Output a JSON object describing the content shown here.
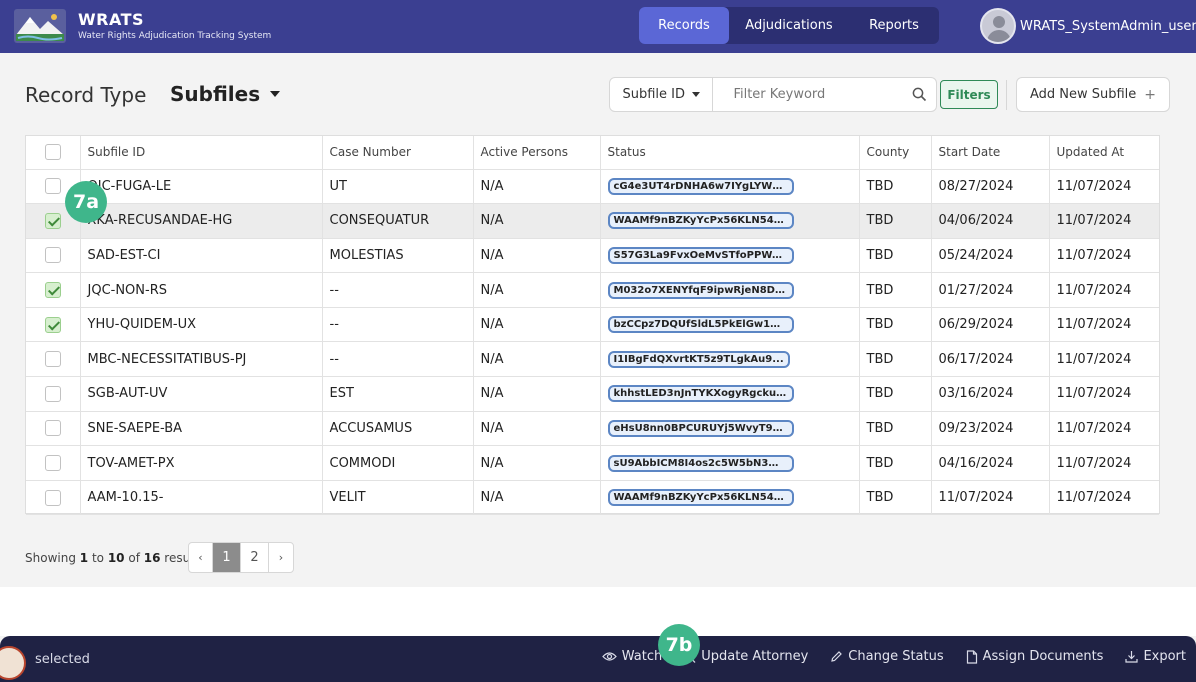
{
  "header": {
    "title": "WRATS",
    "subtitle": "Water Rights Adjudication Tracking System",
    "nav": [
      "Records",
      "Adjudications",
      "Reports"
    ],
    "username": "WRATS_SystemAdmin_user"
  },
  "toolbar": {
    "record_type_label": "Record Type",
    "record_type_value": "Subfiles",
    "filter_field": "Subfile ID",
    "filter_placeholder": "Filter Keyword",
    "filters_label": "Filters",
    "add_label": "Add New Subfile",
    "add_plus": "+"
  },
  "table": {
    "columns": [
      "Subfile ID",
      "Case Number",
      "Active Persons",
      "Status",
      "County",
      "Start Date",
      "Updated At"
    ],
    "rows": [
      {
        "checked": false,
        "id": "OJC-FUGA-LE",
        "case": "UT",
        "persons": "N/A",
        "status": "cG4e3UT4rDNHA6w7IYgLYWxi...",
        "county": "TBD",
        "start": "08/27/2024",
        "updated": "11/07/2024"
      },
      {
        "checked": true,
        "id": "XKA-RECUSANDAE-HG",
        "case": "CONSEQUATUR",
        "persons": "N/A",
        "status": "WAAMf9nBZKyYcPx56KLN54zU...",
        "county": "TBD",
        "start": "04/06/2024",
        "updated": "11/07/2024"
      },
      {
        "checked": false,
        "id": "SAD-EST-CI",
        "case": "MOLESTIAS",
        "persons": "N/A",
        "status": "S57G3La9FvxOeMvSTfoPPWou...",
        "county": "TBD",
        "start": "05/24/2024",
        "updated": "11/07/2024"
      },
      {
        "checked": true,
        "id": "JQC-NON-RS",
        "case": "--",
        "persons": "N/A",
        "status": "M032o7XENYfqF9ipwRjeN8DR...",
        "county": "TBD",
        "start": "01/27/2024",
        "updated": "11/07/2024"
      },
      {
        "checked": true,
        "id": "YHU-QUIDEM-UX",
        "case": "--",
        "persons": "N/A",
        "status": "bzCCpz7DQUfSldL5PkElGw1H...",
        "county": "TBD",
        "start": "06/29/2024",
        "updated": "11/07/2024"
      },
      {
        "checked": false,
        "id": "MBC-NECESSITATIBUS-PJ",
        "case": "--",
        "persons": "N/A",
        "status": "I1IBgFdQXvrtKT5z9TLgkAu9...",
        "county": "TBD",
        "start": "06/17/2024",
        "updated": "11/07/2024"
      },
      {
        "checked": false,
        "id": "SGB-AUT-UV",
        "case": "EST",
        "persons": "N/A",
        "status": "khhstLED3nJnTYKXogyRgcku...",
        "county": "TBD",
        "start": "03/16/2024",
        "updated": "11/07/2024"
      },
      {
        "checked": false,
        "id": "SNE-SAEPE-BA",
        "case": "ACCUSAMUS",
        "persons": "N/A",
        "status": "eHsU8nn0BPCURUYj5WvyT90q...",
        "county": "TBD",
        "start": "09/23/2024",
        "updated": "11/07/2024"
      },
      {
        "checked": false,
        "id": "TOV-AMET-PX",
        "case": "COMMODI",
        "persons": "N/A",
        "status": "sU9AbbICM8I4os2c5W5bN3WD...",
        "county": "TBD",
        "start": "04/16/2024",
        "updated": "11/07/2024"
      },
      {
        "checked": false,
        "id": "AAM-10.15-",
        "case": "VELIT",
        "persons": "N/A",
        "status": "WAAMf9nBZKyYcPx56KLN54zU...",
        "county": "TBD",
        "start": "11/07/2024",
        "updated": "11/07/2024"
      }
    ]
  },
  "pagination": {
    "showing": "Showing",
    "from": "1",
    "to_word": "to",
    "to": "10",
    "of_word": "of",
    "total": "16",
    "results": "results",
    "prev": "‹",
    "next": "›",
    "pages": [
      "1",
      "2"
    ],
    "current": "1"
  },
  "bottom_bar": {
    "selected_label": "selected",
    "actions": [
      "Watch",
      "Update Attorney",
      "Change Status",
      "Assign Documents",
      "Export"
    ]
  },
  "markers": {
    "a": "7a",
    "b": "7b"
  },
  "colors": {
    "header_bg": "#3b3f91",
    "nav_active": "#5b67d6",
    "bottom_bar_bg": "#1f2244",
    "filters_green": "#2f8a57",
    "marker_green": "#3fb68b",
    "status_border": "#5c86c4"
  }
}
